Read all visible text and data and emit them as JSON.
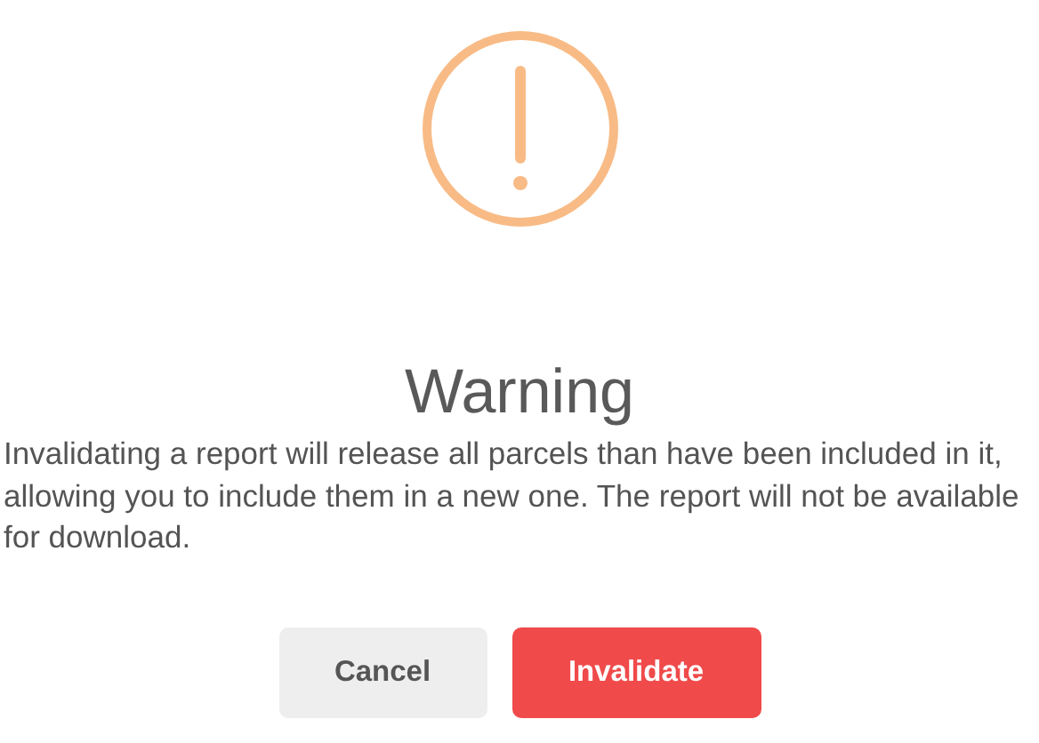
{
  "dialog": {
    "title": "Warning",
    "message": "Invalidating a report will release all parcels than have been included in it, allowing you to include them in a new one. The report will not be available for download.",
    "buttons": [
      {
        "label": "Cancel",
        "kind": "cancel"
      },
      {
        "label": "Invalidate",
        "kind": "confirm"
      }
    ]
  }
}
